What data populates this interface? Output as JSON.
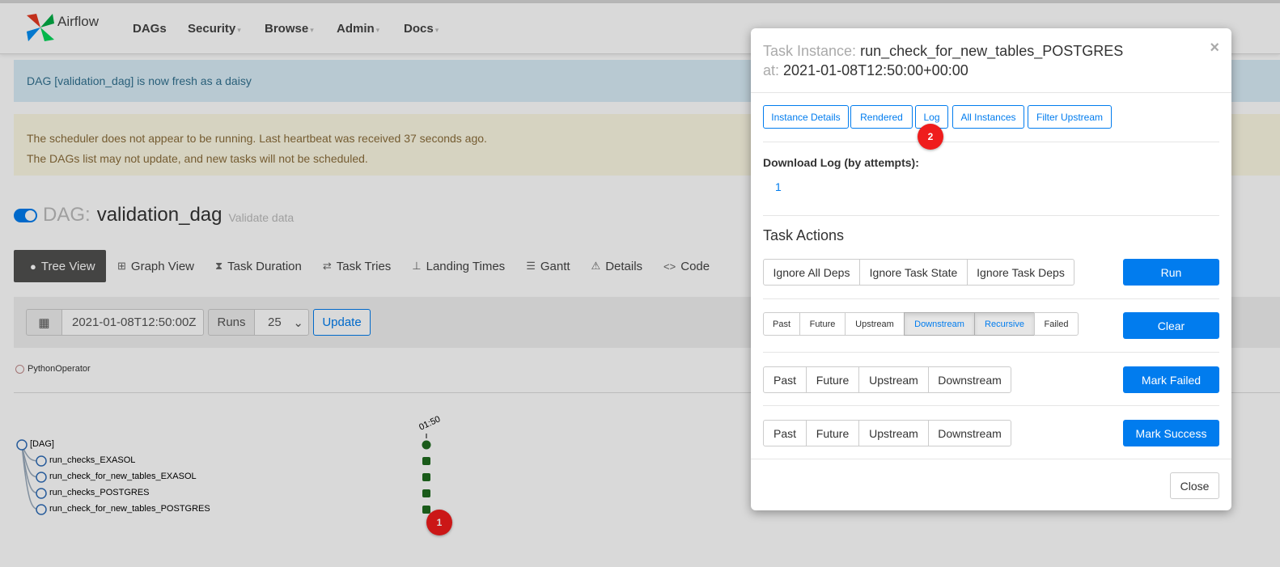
{
  "brand": {
    "name": "Airflow"
  },
  "nav": {
    "items": [
      {
        "label": "DAGs",
        "has_caret": false
      },
      {
        "label": "Security",
        "has_caret": true
      },
      {
        "label": "Browse",
        "has_caret": true
      },
      {
        "label": "Admin",
        "has_caret": true
      },
      {
        "label": "Docs",
        "has_caret": true
      }
    ],
    "caret_glyph": "▾"
  },
  "alerts": {
    "info": "DAG [validation_dag] is now fresh as a daisy",
    "warning_line1": "The scheduler does not appear to be running. Last heartbeat was received 37 seconds ago.",
    "warning_line2": "The DAGs list may not update, and new tasks will not be scheduled."
  },
  "dag": {
    "prefix": "DAG:",
    "name": "validation_dag",
    "description": "Validate data"
  },
  "tabs": [
    {
      "label": "Tree View",
      "icon": "tree-icon",
      "glyph": "●"
    },
    {
      "label": "Graph View",
      "icon": "graph-icon",
      "glyph": "⊞"
    },
    {
      "label": "Task Duration",
      "icon": "hourglass-icon",
      "glyph": "⧗"
    },
    {
      "label": "Task Tries",
      "icon": "retry-icon",
      "glyph": "⇄"
    },
    {
      "label": "Landing Times",
      "icon": "landing-icon",
      "glyph": "⊥"
    },
    {
      "label": "Gantt",
      "icon": "gantt-icon",
      "glyph": "☰"
    },
    {
      "label": "Details",
      "icon": "warning-icon",
      "glyph": "⚠"
    },
    {
      "label": "Code",
      "icon": "code-icon",
      "glyph": "<>"
    }
  ],
  "filter": {
    "calendar_glyph": "▦",
    "base_date": "2021-01-08T12:50:00Z",
    "runs_label": "Runs",
    "runs_value": "25",
    "select_glyph": "⌄",
    "update_label": "Update"
  },
  "legend": {
    "operator": "PythonOperator"
  },
  "tree": {
    "column_time": "01:50",
    "nodes": [
      "[DAG]",
      "run_checks_EXASOL",
      "run_check_for_new_tables_EXASOL",
      "run_checks_POSTGRES",
      "run_check_for_new_tables_POSTGRES"
    ],
    "success_color": "#1f6b1f",
    "node_stroke": "#2f6db7"
  },
  "badges": {
    "step1": "1",
    "step2": "2"
  },
  "modal": {
    "title_prefix": "Task Instance:",
    "task_id": "run_check_for_new_tables_POSTGRES",
    "at_prefix": "at:",
    "execution_date": "2021-01-08T12:50:00+00:00",
    "close_glyph": "×",
    "top_buttons": [
      "Instance Details",
      "Rendered",
      "Log",
      "All Instances",
      "Filter Upstream"
    ],
    "download_label": "Download Log (by attempts):",
    "attempt": "1",
    "task_actions_label": "Task Actions",
    "run_options": [
      "Ignore All Deps",
      "Ignore Task State",
      "Ignore Task Deps"
    ],
    "run_label": "Run",
    "clear_options": [
      {
        "label": "Past",
        "active": false
      },
      {
        "label": "Future",
        "active": false
      },
      {
        "label": "Upstream",
        "active": false
      },
      {
        "label": "Downstream",
        "active": true
      },
      {
        "label": "Recursive",
        "active": true
      },
      {
        "label": "Failed",
        "active": false
      }
    ],
    "clear_label": "Clear",
    "failed_options": [
      "Past",
      "Future",
      "Upstream",
      "Downstream"
    ],
    "mark_failed_label": "Mark Failed",
    "success_options": [
      "Past",
      "Future",
      "Upstream",
      "Downstream"
    ],
    "mark_success_label": "Mark Success",
    "close_label": "Close"
  },
  "colors": {
    "accent": "#017cee",
    "badge": "#ef1c1c",
    "tab_active": "#51504f"
  }
}
